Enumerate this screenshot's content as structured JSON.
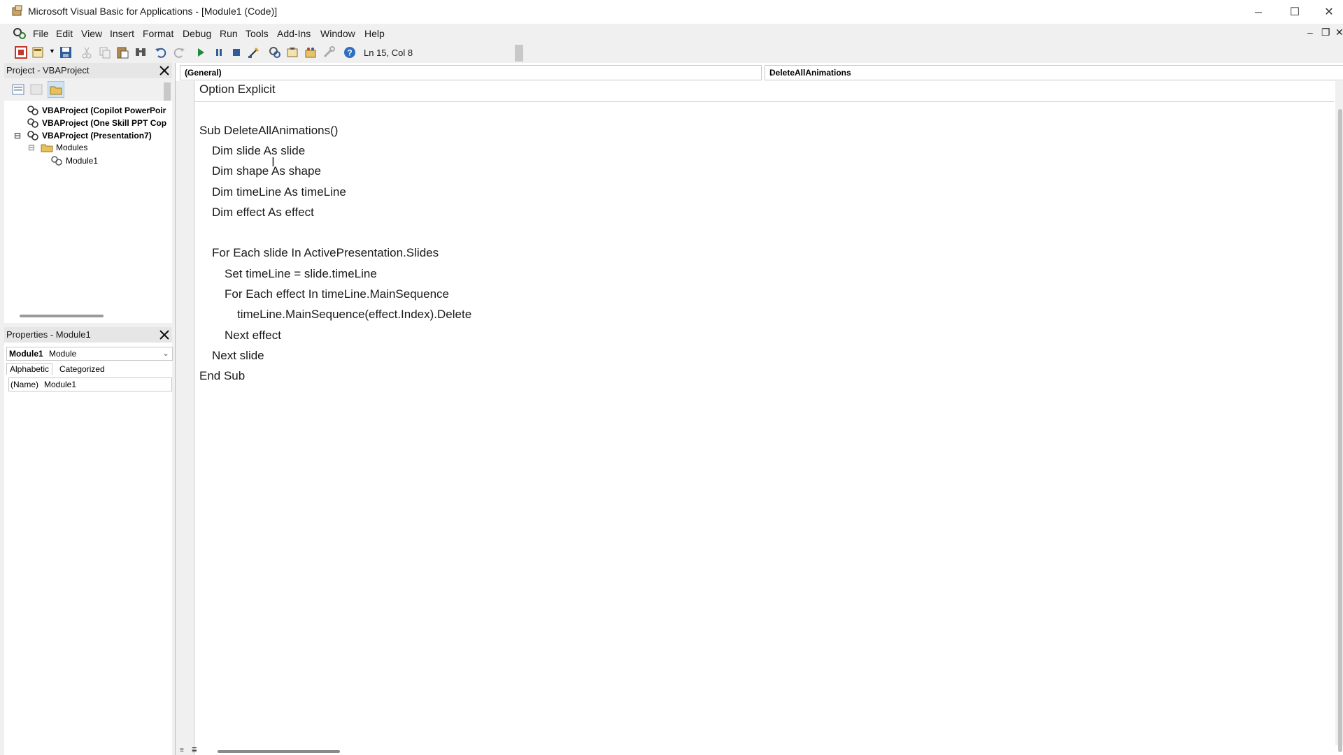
{
  "window": {
    "title": "Microsoft Visual Basic for Applications - [Module1 (Code)]",
    "controls": {
      "minimize": "─",
      "maximize": "☐",
      "close": "✕"
    },
    "mdi_controls": {
      "minimize": "‒",
      "restore": "❐",
      "close": "✕"
    }
  },
  "menu": [
    "File",
    "Edit",
    "View",
    "Insert",
    "Format",
    "Debug",
    "Run",
    "Tools",
    "Add-Ins",
    "Window",
    "Help"
  ],
  "toolbar": {
    "position": "Ln 15, Col 8",
    "icons": [
      "view-host-icon",
      "insert-module-icon",
      "save-icon",
      "cut-icon",
      "copy-icon",
      "paste-icon",
      "find-icon",
      "undo-icon",
      "redo-icon",
      "run-icon",
      "break-icon",
      "reset-icon",
      "design-mode-icon",
      "project-explorer-icon",
      "properties-icon",
      "object-browser-icon",
      "toolbox-icon",
      "help-icon"
    ]
  },
  "project_panel": {
    "title": "Project - VBAProject",
    "tree": [
      {
        "label": "VBAProject (Copilot PowerPoir",
        "level": 0,
        "bold": true,
        "expander": ""
      },
      {
        "label": "VBAProject (One Skill PPT Cop",
        "level": 0,
        "bold": true,
        "expander": ""
      },
      {
        "label": "VBAProject (Presentation7)",
        "level": 0,
        "bold": true,
        "expander": "⊟"
      },
      {
        "label": "Modules",
        "level": 1,
        "bold": false,
        "expander": "⊟"
      },
      {
        "label": "Module1",
        "level": 2,
        "bold": false,
        "expander": ""
      }
    ]
  },
  "properties_panel": {
    "title": "Properties - Module1",
    "object_name": "Module1",
    "object_type": "Module",
    "tabs": [
      "Alphabetic",
      "Categorized"
    ],
    "rows": [
      {
        "name": "(Name)",
        "value": "Module1"
      }
    ]
  },
  "code_window": {
    "object_combo": "(General)",
    "procedure_combo": "DeleteAllAnimations",
    "lines": [
      {
        "text": "Option Explicit",
        "indent": 0
      },
      {
        "text": "",
        "indent": 0
      },
      {
        "text": "Sub DeleteAllAnimations()",
        "indent": 0
      },
      {
        "text": "Dim slide As slide",
        "indent": 1
      },
      {
        "text": "Dim shape As shape",
        "indent": 1
      },
      {
        "text": "Dim timeLine As timeLine",
        "indent": 1
      },
      {
        "text": "Dim effect As effect",
        "indent": 1
      },
      {
        "text": "",
        "indent": 0
      },
      {
        "text": "For Each slide In ActivePresentation.Slides",
        "indent": 1
      },
      {
        "text": "Set timeLine = slide.timeLine",
        "indent": 2
      },
      {
        "text": "For Each effect In timeLine.MainSequence",
        "indent": 2
      },
      {
        "text": "timeLine.MainSequence(effect.Index).Delete",
        "indent": 3
      },
      {
        "text": "Next effect",
        "indent": 2
      },
      {
        "text": "Next slide",
        "indent": 1
      },
      {
        "text": "End Sub",
        "indent": 0
      }
    ]
  }
}
